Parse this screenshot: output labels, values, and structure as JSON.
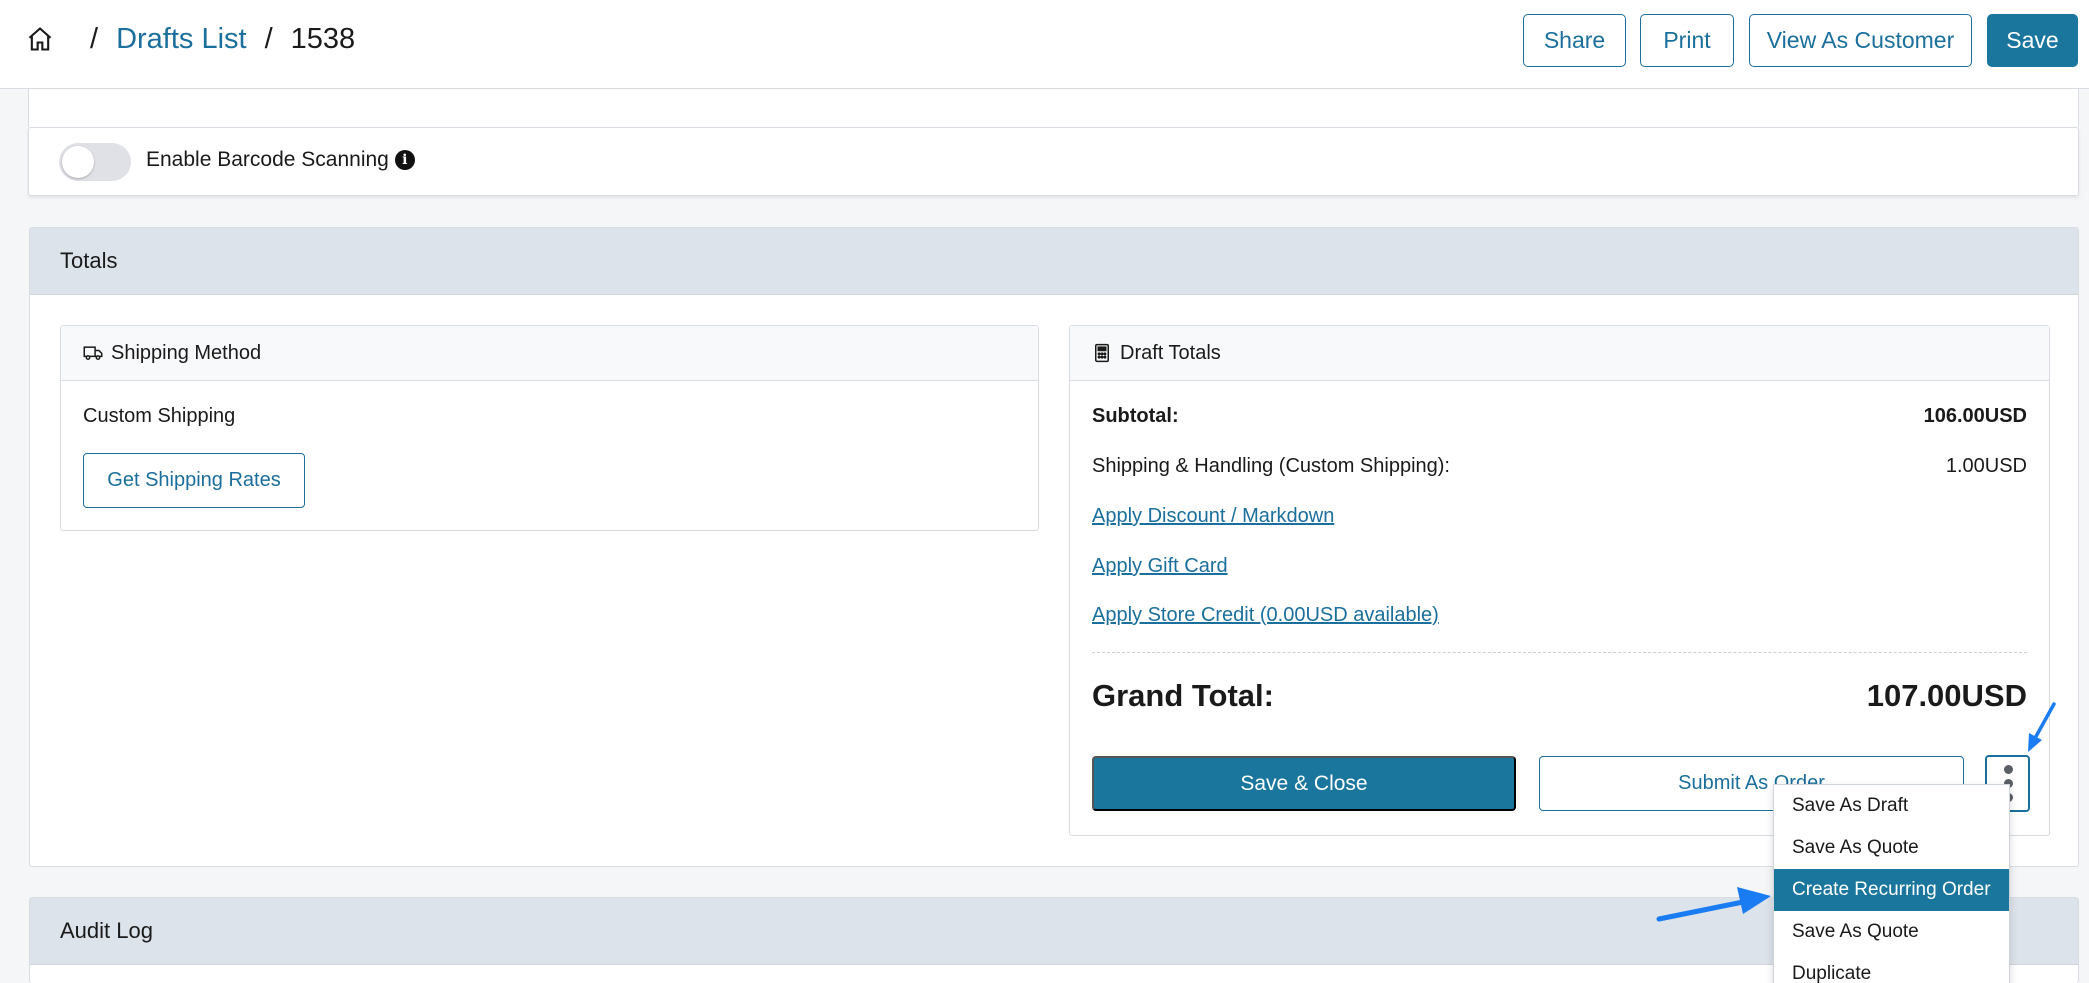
{
  "breadcrumb": {
    "home_icon": "home-icon",
    "separator": "/",
    "drafts_link": "Drafts List",
    "current": "1538"
  },
  "header_actions": {
    "share": "Share",
    "print": "Print",
    "view_as_customer": "View As Customer",
    "save": "Save"
  },
  "barcode": {
    "label": "Enable Barcode Scanning",
    "enabled": false,
    "info_icon": "info-icon"
  },
  "totals_section": {
    "title": "Totals",
    "shipping": {
      "title": "Shipping Method",
      "icon": "truck-icon",
      "method": "Custom Shipping",
      "get_rates_button": "Get Shipping Rates"
    },
    "draft_totals": {
      "title": "Draft Totals",
      "icon": "calculator-icon",
      "subtotal_label": "Subtotal:",
      "subtotal_value": "106.00USD",
      "shipping_label": "Shipping & Handling (Custom Shipping):",
      "shipping_value": "1.00USD",
      "apply_discount": "Apply Discount / Markdown",
      "apply_gift_card": "Apply Gift Card",
      "apply_store_credit": "Apply Store Credit (0.00USD available)",
      "grand_total_label": "Grand Total:",
      "grand_total_value": "107.00USD",
      "save_close_button": "Save & Close",
      "submit_order_button": "Submit As Order"
    }
  },
  "actions_menu": {
    "items": [
      "Save As Draft",
      "Save As Quote",
      "Create Recurring Order",
      "Save As Quote",
      "Duplicate"
    ],
    "highlighted": "Create Recurring Order"
  },
  "audit_log": {
    "title": "Audit Log"
  },
  "colors": {
    "primary": "#1b769e",
    "link": "#1b6f9c",
    "section_header": "#dde3ea",
    "annotation_arrow": "#1a7cf2"
  }
}
